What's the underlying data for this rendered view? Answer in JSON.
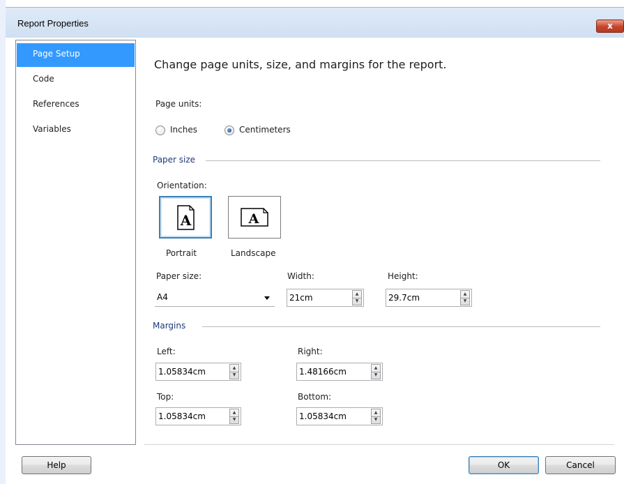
{
  "window": {
    "title": "Report Properties",
    "close_label": "x"
  },
  "nav": {
    "items": [
      "Page Setup",
      "Code",
      "References",
      "Variables"
    ],
    "selected": "Page Setup"
  },
  "page": {
    "heading": "Change page units, size, and margins for the report.",
    "page_units_label": "Page units:",
    "units": {
      "inches": "Inches",
      "centimeters": "Centimeters",
      "selected": "Centimeters"
    },
    "paper_size_group": "Paper size",
    "orientation_label": "Orientation:",
    "orientation": {
      "portrait": "Portrait",
      "landscape": "Landscape",
      "selected": "Portrait",
      "glyph": "A"
    },
    "paper_size_label": "Paper size:",
    "paper_size_value": "A4",
    "width_label": "Width:",
    "width_value": "21cm",
    "height_label": "Height:",
    "height_value": "29.7cm",
    "margins_group": "Margins",
    "left_label": "Left:",
    "left_value": "1.05834cm",
    "right_label": "Right:",
    "right_value": "1.48166cm",
    "top_label": "Top:",
    "top_value": "1.05834cm",
    "bottom_label": "Bottom:",
    "bottom_value": "1.05834cm"
  },
  "footer": {
    "help": "Help",
    "ok": "OK",
    "cancel": "Cancel"
  },
  "colors": {
    "selection": "#3399ff",
    "group_title": "#1e3a78",
    "close_button": "#c7432a"
  },
  "icons": {
    "close": "close-icon",
    "dropdown": "chevron-down-icon",
    "spin": "spinner-arrows-icon"
  }
}
